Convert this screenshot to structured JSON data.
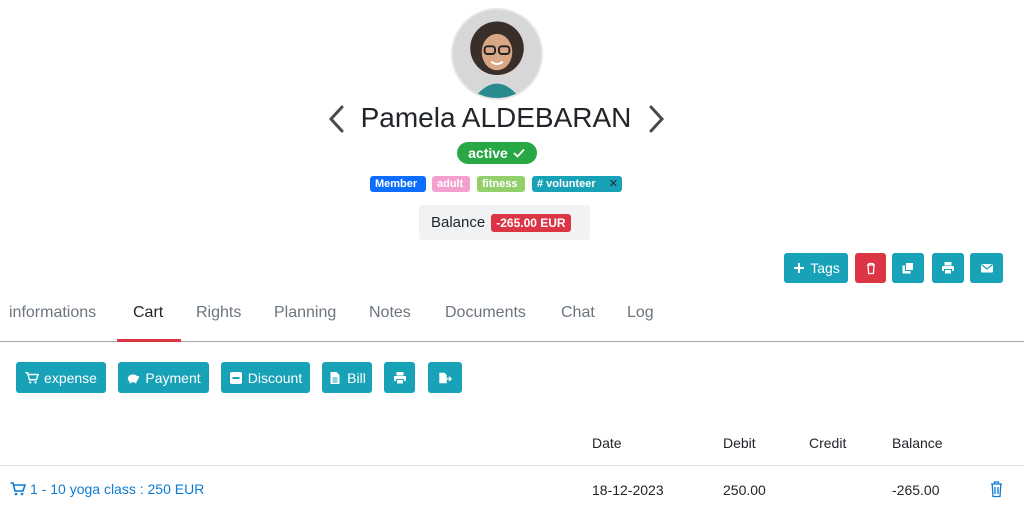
{
  "profile": {
    "name": "Pamela ALDEBARAN",
    "status": "active",
    "tags": [
      "Member",
      "adult",
      "fitness",
      "# volunteer"
    ],
    "balance_label": "Balance",
    "balance_value": "-265.00 EUR"
  },
  "toolbar": {
    "tags_label": "Tags"
  },
  "tabs": [
    "informations",
    "Cart",
    "Rights",
    "Planning",
    "Notes",
    "Documents",
    "Chat",
    "Log"
  ],
  "active_tab": "Cart",
  "actions": {
    "expense": "expense",
    "payment": "Payment",
    "discount": "Discount",
    "bill": "Bill"
  },
  "table": {
    "headers": [
      "Date",
      "Debit",
      "Credit",
      "Balance"
    ],
    "rows": [
      {
        "item": "1 - 10 yoga class : 250 EUR",
        "date": "18-12-2023",
        "debit": "250.00",
        "credit": "",
        "balance": "-265.00"
      }
    ]
  },
  "colors": {
    "teal": "#17a2b8",
    "danger": "#dc3545",
    "success": "#28a745",
    "primary": "#0d6efd"
  }
}
